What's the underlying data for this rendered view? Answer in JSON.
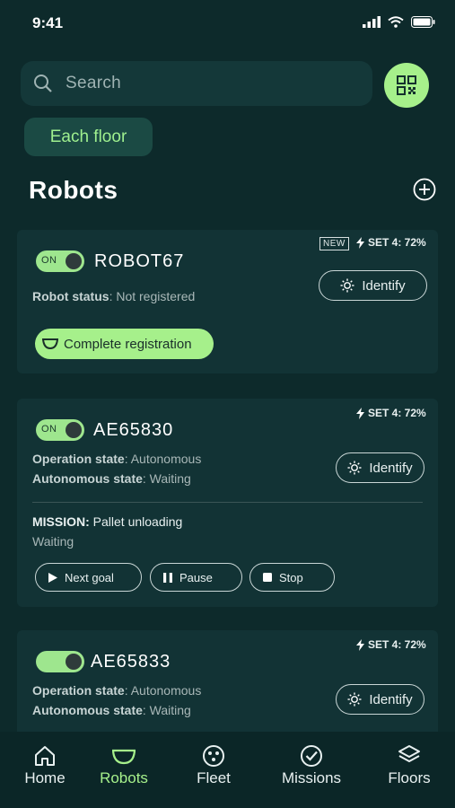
{
  "status_bar": {
    "time": "9:41"
  },
  "search": {
    "placeholder": "Search"
  },
  "filter_chip": "Each floor",
  "section": {
    "title": "Robots"
  },
  "robots": [
    {
      "toggle": "ON",
      "name": "ROBOT67",
      "badge": "NEW",
      "battery": "SET 4: 72%",
      "status_label": "Robot status",
      "status_value": ": Not registered",
      "identify": "Identify",
      "registration": "Complete registration"
    },
    {
      "toggle": "ON",
      "name": "AE65830",
      "battery": "SET 4: 72%",
      "op_label": "Operation state",
      "op_value": ": Autonomous",
      "auto_label": "Autonomous state",
      "auto_value": ": Waiting",
      "identify": "Identify",
      "mission_label": "MISSION:",
      "mission_value": " Pallet unloading",
      "mission_status": "Waiting",
      "controls": [
        "Next goal",
        "Pause",
        "Stop"
      ]
    },
    {
      "name": "AE65833",
      "battery": "SET 4: 72%",
      "op_label": "Operation state",
      "op_value": ": Autonomous",
      "auto_label": "Autonomous state",
      "auto_value": ": Waiting",
      "identify": "Identify"
    }
  ],
  "tabs": [
    {
      "label": "Home",
      "icon": "home-icon"
    },
    {
      "label": "Robots",
      "icon": "robot-icon",
      "active": true
    },
    {
      "label": "Fleet",
      "icon": "fleet-icon"
    },
    {
      "label": "Missions",
      "icon": "missions-icon"
    },
    {
      "label": "Floors",
      "icon": "floors-icon"
    }
  ],
  "colors": {
    "background": "#0d2a2b",
    "card": "#123335",
    "accent": "#a6f08b",
    "accent_text": "#9ff08f"
  }
}
